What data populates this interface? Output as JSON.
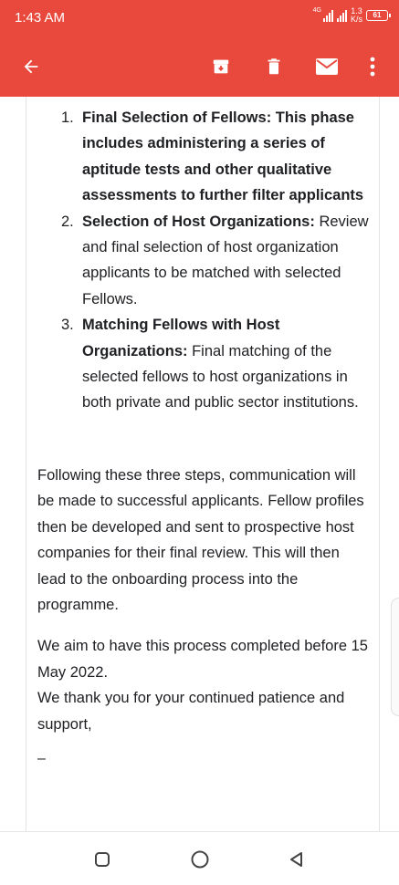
{
  "status_bar": {
    "time": "1:43 AM",
    "network": "4G",
    "speed_value": "1.3",
    "speed_unit": "K/s",
    "battery": "61"
  },
  "toolbar": {
    "icons": [
      "back-arrow-icon",
      "archive-icon",
      "delete-icon",
      "mark-unread-icon",
      "more-vert-icon"
    ],
    "color": "#e8493c"
  },
  "email": {
    "steps": [
      {
        "number": "1.",
        "title": "Final Selection of Fellows:",
        "text": " This phase includes administering a series of aptitude tests and other qualitative assessments to further filter applicants"
      },
      {
        "number": "2.",
        "title": "Selection of Host Organizations:",
        "text": " Review and final selection of host organization applicants to be matched with selected Fellows."
      },
      {
        "number": "3.",
        "title": "Matching Fellows with Host Organizations:",
        "text": " Final matching of the selected fellows to host organizations in both private and public sector institutions."
      }
    ],
    "paragraph_1": "Following these three steps, communication will be made to successful applicants. Fellow profiles then be developed and sent to prospective host companies for their final review. This will then lead to the onboarding process into the programme.",
    "paragraph_2a": "We aim to have this process completed before 15 May 2022.",
    "paragraph_2b": "We thank you for your continued patience and support,",
    "signature_dash": "–"
  },
  "nav_bar": {
    "icons": [
      "recent-apps-icon",
      "home-icon",
      "back-triangle-icon"
    ]
  }
}
